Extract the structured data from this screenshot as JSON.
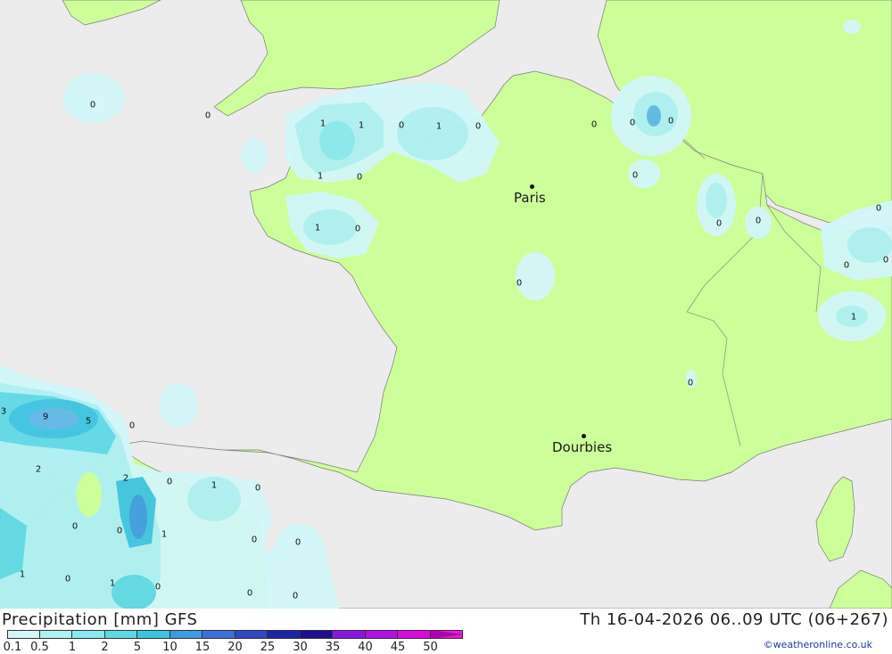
{
  "footer": {
    "title": "Precipitation [mm] GFS",
    "datetime": "Th 16-04-2026 06..09 UTC (06+267)",
    "credit": "©weatheronline.co.uk"
  },
  "scale": {
    "labels": [
      "0.1",
      "0.5",
      "1",
      "2",
      "5",
      "10",
      "15",
      "20",
      "25",
      "30",
      "35",
      "40",
      "45",
      "50"
    ],
    "colors": [
      "#d2f7f9",
      "#aef0f4",
      "#8ae8ee",
      "#5fd8e6",
      "#3ec3e0",
      "#3e9be0",
      "#3c70d8",
      "#2d49c4",
      "#1a26a8",
      "#1e0e90",
      "#8a16e6",
      "#b30fe6",
      "#d80ae0",
      "#e61ad2",
      "#b000b0"
    ]
  },
  "colors": {
    "land": "#ccff99",
    "sea": "#ececec",
    "precip_light": "#d2f7f9",
    "precip_mid": "#aef0f4",
    "precip_heavy": "#8ae8ee",
    "precip_strong": "#5fb8e6"
  },
  "cities": [
    {
      "name": "Paris"
    },
    {
      "name": "Dourbies"
    }
  ],
  "values": [
    "0",
    "0",
    "1",
    "1",
    "0",
    "1",
    "0",
    "1",
    "0",
    "1",
    "0",
    "0",
    "0",
    "0",
    "0",
    "0",
    "0",
    "0",
    "0",
    "0",
    "1",
    "0",
    "3",
    "9",
    "5",
    "0",
    "2",
    "2",
    "0",
    "1",
    "0",
    "0",
    "0",
    "1",
    "0",
    "0",
    "1",
    "0",
    "1",
    "0",
    "0",
    "0",
    "0",
    "0"
  ]
}
